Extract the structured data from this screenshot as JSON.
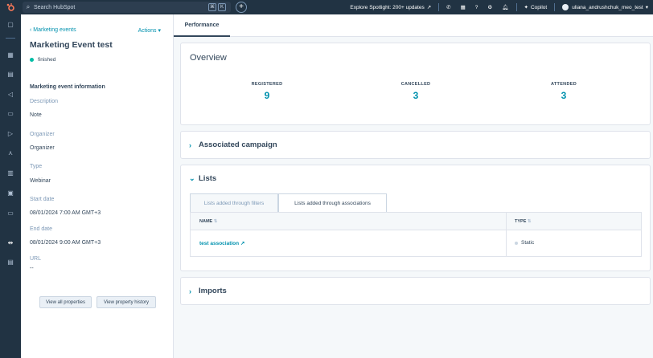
{
  "topbar": {
    "search_placeholder": "Search HubSpot",
    "kbd1": "⌘",
    "kbd2": "K",
    "spotlight": "Explore Spotlight: 200+ updates",
    "copilot": "Copilot",
    "account": "uliana_andrushchuk_meo_test"
  },
  "left": {
    "breadcrumb": "Marketing events",
    "actions": "Actions",
    "title": "Marketing Event test",
    "status": "finished",
    "section_title": "Marketing event information",
    "properties": [
      {
        "label": "Description",
        "value": "Note"
      },
      {
        "label": "Organizer",
        "value": "Organizer"
      },
      {
        "label": "Type",
        "value": "Webinar"
      },
      {
        "label": "Start date",
        "value": "08/01/2024 7:00 AM GMT+3"
      },
      {
        "label": "End date",
        "value": "08/01/2024 9:00 AM GMT+3"
      },
      {
        "label": "URL",
        "value": "--"
      }
    ],
    "btn_all_props": "View all properties",
    "btn_history": "View property history"
  },
  "main": {
    "tab_performance": "Performance",
    "overview": {
      "title": "Overview",
      "stats": [
        {
          "label": "REGISTERED",
          "value": "9"
        },
        {
          "label": "CANCELLED",
          "value": "3"
        },
        {
          "label": "ATTENDED",
          "value": "3"
        }
      ]
    },
    "associated_campaign": "Associated campaign",
    "lists": {
      "title": "Lists",
      "tab_filters": "Lists added through filters",
      "tab_associations": "Lists added through associations",
      "col_name": "NAME",
      "col_type": "TYPE",
      "rows": [
        {
          "name": "test association",
          "type": "Static"
        }
      ]
    },
    "imports": "Imports"
  },
  "colors": {
    "accent": "#0091ae",
    "nav": "#213343",
    "status": "#00bda5"
  }
}
